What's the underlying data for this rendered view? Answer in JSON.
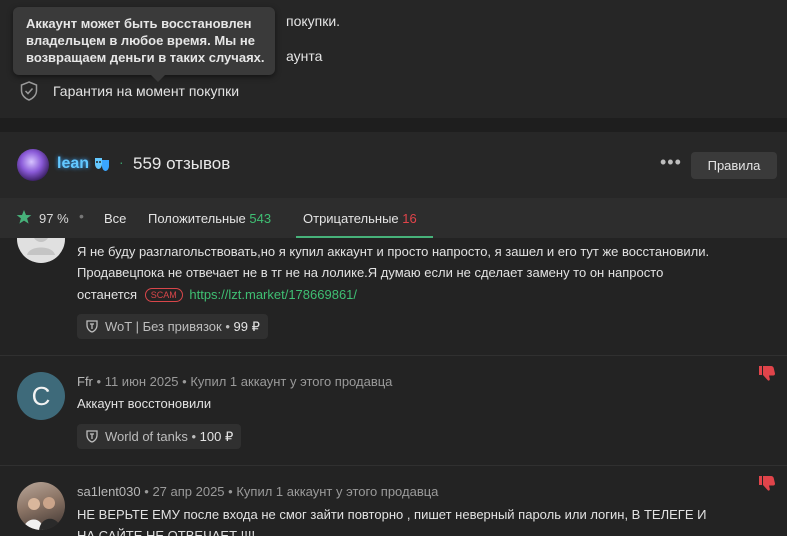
{
  "top": {
    "line1_tail": "покупки.",
    "line2_tail": "аунта",
    "guarantee": "Гарантия на момент покупки"
  },
  "tooltip": {
    "lines": [
      "Аккаунт может быть восстановлен",
      "владельцем в любое время. Мы не",
      "возвращаем деньги в таких случаях."
    ]
  },
  "header": {
    "seller_name": "lean",
    "separator": "·",
    "review_count": "559 отзывов",
    "more_icon": "•••",
    "rules_button": "Правила"
  },
  "tabs": {
    "rating": "97 %",
    "dot": "•",
    "all": "Все",
    "positive_label": "Положительные",
    "positive_count": "543",
    "negative_label": "Отрицательные",
    "negative_count": "16",
    "active": "negative"
  },
  "reviews": [
    {
      "body": [
        "Я не буду разглагольствовать,но я купил аккаунт и просто напросто, я зашел и его тут же восстановили.",
        "Продавецпока не отвечает не в тг не на лолике.Я думаю если не сделает замену то он напросто",
        "останется"
      ],
      "tag": "SCAM",
      "link": "https://lzt.market/178669861/",
      "product": "WoT | Без привязок",
      "price": "99 ₽"
    },
    {
      "avatar_letter": "C",
      "author": "Ffr",
      "date": "11 июн 2025",
      "purchase": "Купил 1 аккаунт у этого продавца",
      "body": [
        "Аккаунт восстоновили"
      ],
      "product": "World of tanks",
      "price": "100 ₽"
    },
    {
      "author": "sa1lent030",
      "date": "27 апр 2025",
      "purchase": "Купил 1 аккаунт у этого продавца",
      "body": [
        "НЕ ВЕРЬТЕ ЕМУ после входа не смог зайти повторно , пишет неверный пароль или логин, В ТЕЛЕГЕ И",
        "НА САЙТЕ НЕ ОТВЕЧАЕТ !!!!"
      ]
    }
  ],
  "meta_dot": "•",
  "colors": {
    "accent_green": "#47b27a",
    "negative_red": "#e0444a",
    "seller_name": "#63c8ff"
  }
}
